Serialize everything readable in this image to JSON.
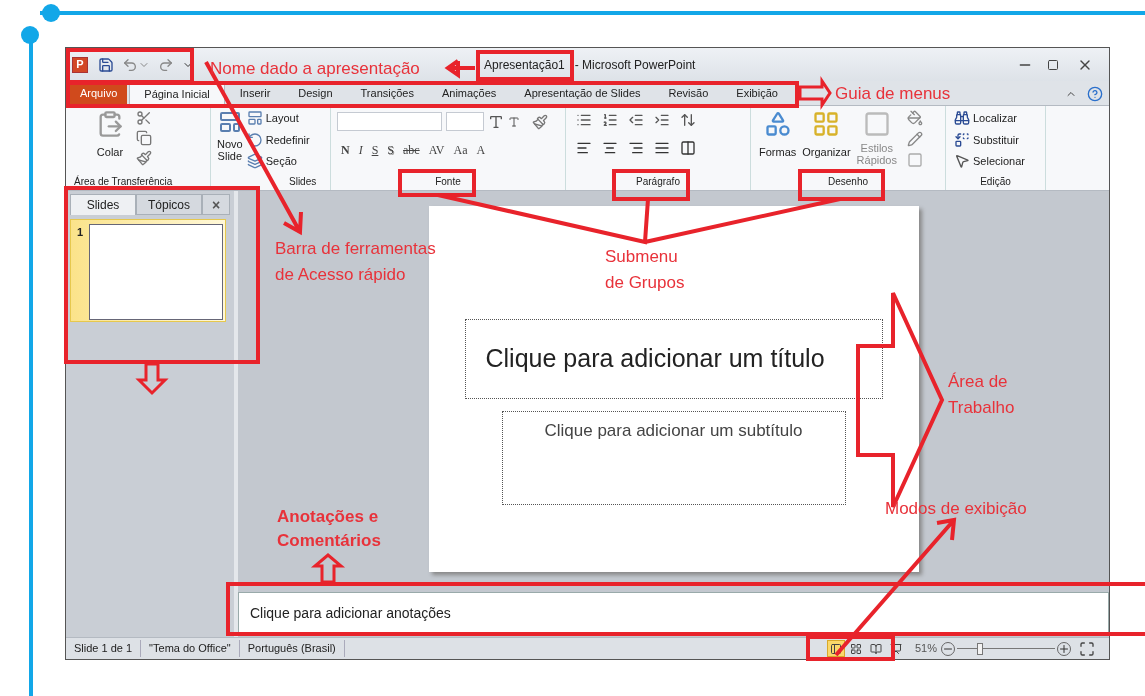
{
  "window": {
    "app_icon_letter": "P",
    "document_title": "Apresentação1",
    "app_title": "- Microsoft PowerPoint"
  },
  "tabs": [
    {
      "label": "Arquivo",
      "kind": "file",
      "selected": false
    },
    {
      "label": "Página Inicial",
      "kind": "tab",
      "selected": true
    },
    {
      "label": "Inserir",
      "kind": "tab",
      "selected": false
    },
    {
      "label": "Design",
      "kind": "tab",
      "selected": false
    },
    {
      "label": "Transições",
      "kind": "tab",
      "selected": false
    },
    {
      "label": "Animações",
      "kind": "tab",
      "selected": false
    },
    {
      "label": "Apresentação de Slides",
      "kind": "tab",
      "selected": false
    },
    {
      "label": "Revisão",
      "kind": "tab",
      "selected": false
    },
    {
      "label": "Exibição",
      "kind": "tab",
      "selected": false
    }
  ],
  "ribbon": {
    "clipboard": {
      "label": "Área de Transferência",
      "paste": "Colar"
    },
    "slides": {
      "label": "Slides",
      "new_slide": [
        "Novo",
        "Slide"
      ],
      "layout": "Layout",
      "reset": "Redefinir",
      "section": "Seção"
    },
    "font": {
      "label": "Fonte",
      "buttons": [
        "N",
        "I",
        "S",
        "S",
        "abc",
        "AV",
        "Aa",
        "A"
      ]
    },
    "paragraph": {
      "label": "Parágrafo"
    },
    "drawing": {
      "label": "Desenho",
      "shapes": "Formas",
      "arrange": "Organizar",
      "styles": [
        "Estilos",
        "Rápidos"
      ]
    },
    "editing": {
      "label": "Edição",
      "find": "Localizar",
      "replace": "Substituir",
      "select": "Selecionar"
    }
  },
  "slide_pane": {
    "tabs": [
      {
        "label": "Slides",
        "selected": true
      },
      {
        "label": "Tópicos",
        "selected": false
      }
    ],
    "close": "×",
    "thumbnails": [
      {
        "number": "1",
        "selected": true
      }
    ]
  },
  "slide": {
    "title_placeholder": "Clique para adicionar um título",
    "subtitle_placeholder": "Clique para adicionar um subtítulo"
  },
  "notes": {
    "placeholder": "Clique para adicionar anotações"
  },
  "status_bar": {
    "items": [
      "Slide 1 de 1",
      "\"Tema do Office\"",
      "Português (Brasil)"
    ],
    "view_buttons": [
      {
        "selected": true
      },
      {
        "selected": false
      },
      {
        "selected": false
      },
      {
        "selected": false
      }
    ],
    "zoom": "51%",
    "zoom_slider": {
      "level": 0.22
    }
  },
  "annotations": [
    {
      "text": "Nome dado a apresentação",
      "bold": false
    },
    {
      "text": "Guia de menus",
      "bold": false
    },
    {
      "text": "Barra de ferramentas de Acesso rápido",
      "bold": false
    },
    {
      "text": "Submenu de Grupos",
      "bold": false
    },
    {
      "text": "Área de Trabalho",
      "bold": false
    },
    {
      "text": "Modos de exibição",
      "bold": false
    },
    {
      "text": "Anotações e Comentários",
      "bold": true
    }
  ]
}
